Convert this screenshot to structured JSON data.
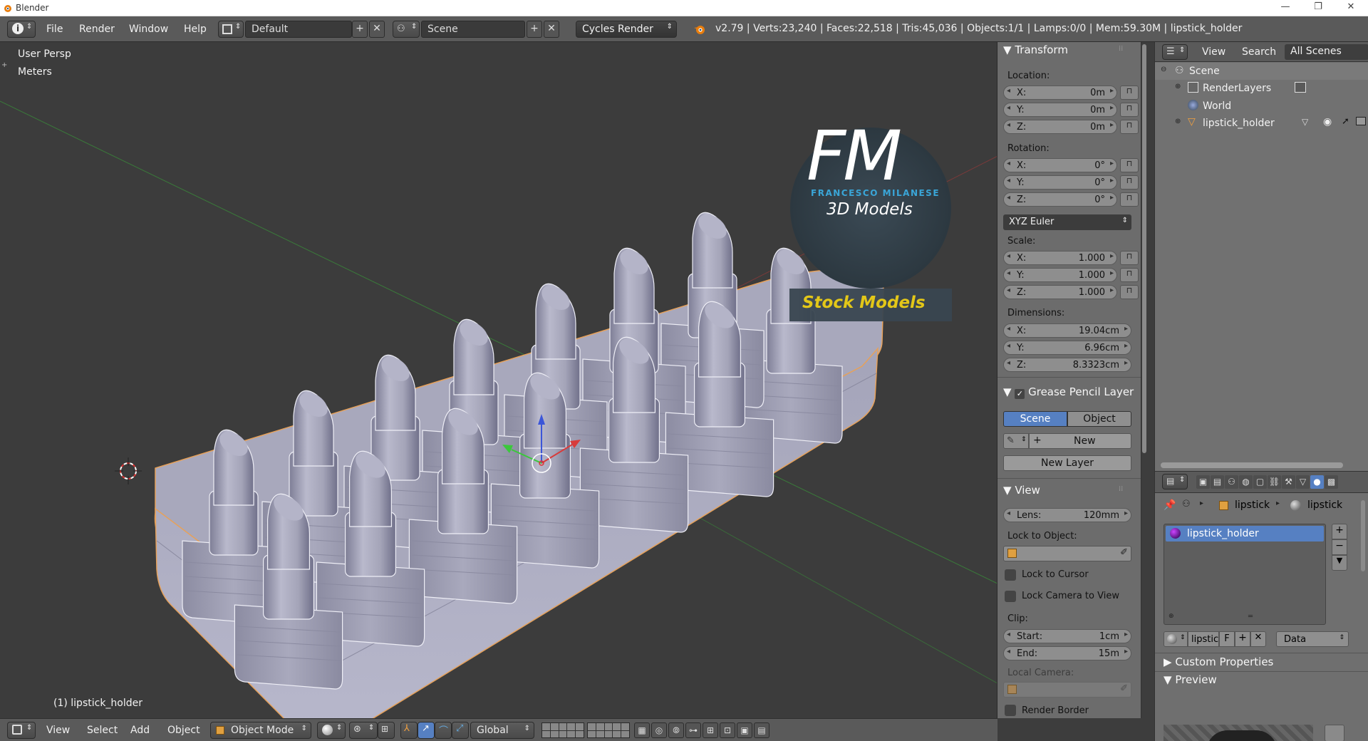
{
  "window": {
    "title": "Blender",
    "controls": [
      "—",
      "❐",
      "✕"
    ]
  },
  "topbar": {
    "menus": [
      "File",
      "Render",
      "Window",
      "Help"
    ],
    "screen_layout": "Default",
    "scene": "Scene",
    "engine": "Cycles Render",
    "stats": "v2.79 | Verts:23,240 | Faces:22,518 | Tris:45,036 | Objects:1/1 | Lamps:0/0 | Mem:59.30M | lipstick_holder"
  },
  "viewport": {
    "view_name": "User Persp",
    "units": "Meters",
    "active_object": "(1) lipstick_holder",
    "watermark": {
      "initials": "FM",
      "name": "FRANCESCO MILANESE",
      "subtitle": "3D Models",
      "banner": "Stock Models"
    }
  },
  "npanel": {
    "transform": {
      "header": "Transform",
      "location_label": "Location:",
      "location": [
        {
          "axis": "X:",
          "value": "0m"
        },
        {
          "axis": "Y:",
          "value": "0m"
        },
        {
          "axis": "Z:",
          "value": "0m"
        }
      ],
      "rotation_label": "Rotation:",
      "rotation": [
        {
          "axis": "X:",
          "value": "0°"
        },
        {
          "axis": "Y:",
          "value": "0°"
        },
        {
          "axis": "Z:",
          "value": "0°"
        }
      ],
      "rotation_mode": "XYZ Euler",
      "scale_label": "Scale:",
      "scale": [
        {
          "axis": "X:",
          "value": "1.000"
        },
        {
          "axis": "Y:",
          "value": "1.000"
        },
        {
          "axis": "Z:",
          "value": "1.000"
        }
      ],
      "dimensions_label": "Dimensions:",
      "dimensions": [
        {
          "axis": "X:",
          "value": "19.04cm"
        },
        {
          "axis": "Y:",
          "value": "6.96cm"
        },
        {
          "axis": "Z:",
          "value": "8.3323cm"
        }
      ]
    },
    "grease_pencil": {
      "header": "Grease Pencil Layer",
      "tab_scene": "Scene",
      "tab_object": "Object",
      "new_label": "New",
      "new_layer_label": "New Layer"
    },
    "view": {
      "header": "View",
      "lens_label": "Lens:",
      "lens_value": "120mm",
      "lock_to_object_label": "Lock to Object:",
      "lock_to_cursor": "Lock to Cursor",
      "lock_camera_to_view": "Lock Camera to View",
      "clip_label": "Clip:",
      "clip_start_label": "Start:",
      "clip_start_value": "1cm",
      "clip_end_label": "End:",
      "clip_end_value": "15m",
      "local_camera_label": "Local Camera:",
      "render_border": "Render Border"
    }
  },
  "outliner": {
    "view_menu": "View",
    "search_menu": "Search",
    "display_mode": "All Scenes",
    "items": [
      {
        "label": "Scene"
      },
      {
        "label": "RenderLayers"
      },
      {
        "label": "World"
      },
      {
        "label": "lipstick_holder"
      }
    ]
  },
  "properties": {
    "breadcrumb_1": "lipstick",
    "breadcrumb_2": "lipstick",
    "material_slot": "lipstick_holder",
    "material_name": "lipstic",
    "fake_user": "F",
    "link_mode": "Data",
    "custom_properties": "Custom Properties",
    "preview": "Preview"
  },
  "bottombar": {
    "menus": [
      "View",
      "Select",
      "Add",
      "Object"
    ],
    "mode": "Object Mode",
    "orientation": "Global"
  },
  "colors": {
    "accent_blue": "#5680c2",
    "selection_orange": "#f0a040",
    "viewport_bg": "#3c3c3c",
    "panel_bg": "#6c6c6c"
  }
}
